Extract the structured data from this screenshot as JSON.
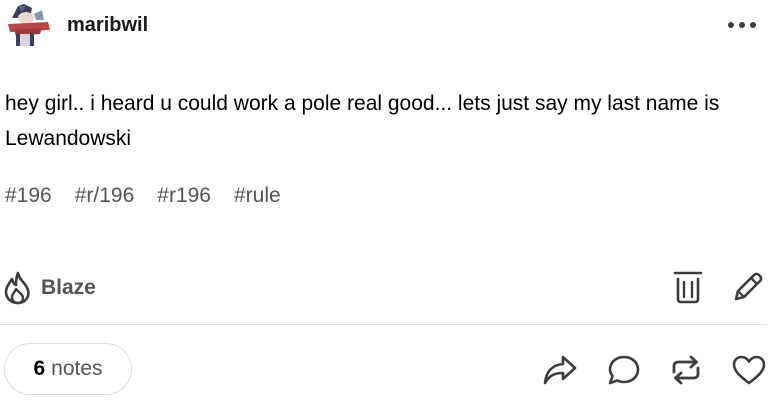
{
  "post": {
    "username": "maribwil",
    "body": "hey girl.. i heard u could work a pole real good... lets just say my last name is Lewandowski",
    "tags": [
      "#196",
      "#r/196",
      "#r196",
      "#rule"
    ]
  },
  "actions": {
    "blaze_label": "Blaze",
    "icons": [
      "more-horizontal-icon",
      "flame-icon",
      "trash-icon",
      "pencil-icon",
      "share-icon",
      "reply-icon",
      "reblog-icon",
      "heart-icon"
    ]
  },
  "notes": {
    "count": "6",
    "label": "notes"
  },
  "colors": {
    "text": "#000000",
    "muted": "#555555",
    "divider": "#e0e0e0",
    "icon": "#3c3c3c"
  }
}
